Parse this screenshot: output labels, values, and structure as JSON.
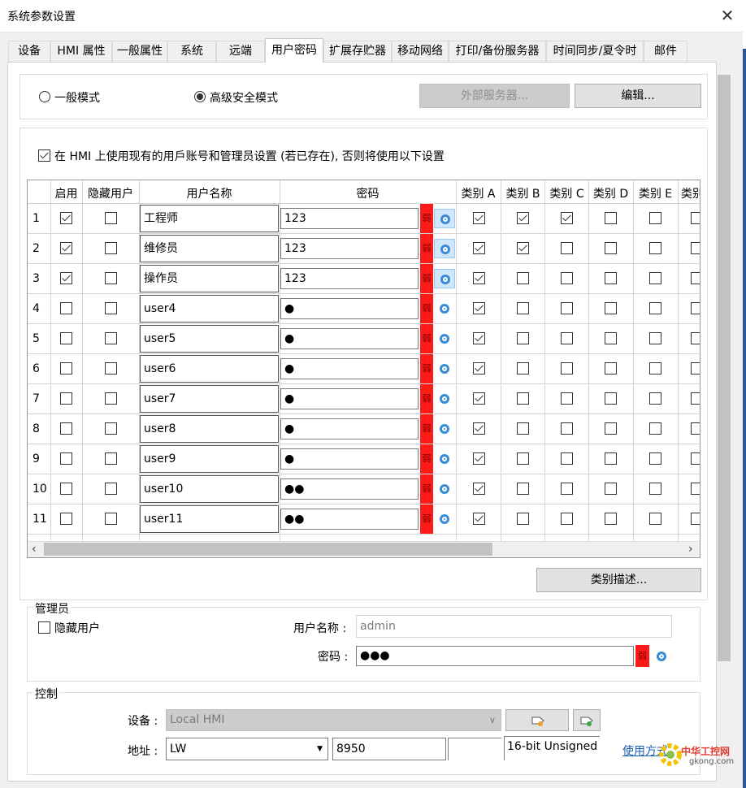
{
  "window": {
    "title": "系统参数设置",
    "close_glyph": "✕"
  },
  "tabs": [
    {
      "label": "设备",
      "active": false
    },
    {
      "label": "HMI 属性",
      "active": false
    },
    {
      "label": "一般属性",
      "active": false
    },
    {
      "label": "系统",
      "active": false
    },
    {
      "label": "远端",
      "active": false
    },
    {
      "label": "用户密码",
      "active": true
    },
    {
      "label": "扩展存贮器",
      "active": false
    },
    {
      "label": "移动网络",
      "active": false
    },
    {
      "label": "打印/备份服务器",
      "active": false
    },
    {
      "label": "时间同步/夏令时",
      "active": false
    },
    {
      "label": "邮件",
      "active": false
    }
  ],
  "mode": {
    "general_label": "一般模式",
    "advanced_label": "高级安全模式",
    "selected": "advanced",
    "external_server_label": "外部服务器...",
    "edit_label": "编辑..."
  },
  "use_existing": {
    "checked": true,
    "label": "在 HMI 上使用现有的用戶账号和管理员设置 (若已存在), 否则将使用以下设置"
  },
  "grid": {
    "headers": {
      "enable": "启用",
      "hidden": "隐藏用户",
      "username": "用户名称",
      "password": "密码",
      "categories": [
        "类别 A",
        "类别 B",
        "类别 C",
        "类别 D",
        "类别 E",
        "类别"
      ]
    },
    "weak_label": "弱",
    "rows": [
      {
        "num": "1",
        "enabled": true,
        "hidden": false,
        "name": "工程师",
        "password": "123",
        "eye_hl": true,
        "cats": [
          true,
          true,
          true,
          false,
          false,
          false
        ]
      },
      {
        "num": "2",
        "enabled": true,
        "hidden": false,
        "name": "维修员",
        "password": "123",
        "eye_hl": true,
        "cats": [
          true,
          true,
          false,
          false,
          false,
          false
        ]
      },
      {
        "num": "3",
        "enabled": true,
        "hidden": false,
        "name": "操作员",
        "password": "123",
        "eye_hl": true,
        "cats": [
          true,
          false,
          false,
          false,
          false,
          false
        ]
      },
      {
        "num": "4",
        "enabled": false,
        "hidden": false,
        "name": "user4",
        "password": "●",
        "eye_hl": false,
        "cats": [
          true,
          false,
          false,
          false,
          false,
          false
        ]
      },
      {
        "num": "5",
        "enabled": false,
        "hidden": false,
        "name": "user5",
        "password": "●",
        "eye_hl": false,
        "cats": [
          true,
          false,
          false,
          false,
          false,
          false
        ]
      },
      {
        "num": "6",
        "enabled": false,
        "hidden": false,
        "name": "user6",
        "password": "●",
        "eye_hl": false,
        "cats": [
          true,
          false,
          false,
          false,
          false,
          false
        ]
      },
      {
        "num": "7",
        "enabled": false,
        "hidden": false,
        "name": "user7",
        "password": "●",
        "eye_hl": false,
        "cats": [
          true,
          false,
          false,
          false,
          false,
          false
        ]
      },
      {
        "num": "8",
        "enabled": false,
        "hidden": false,
        "name": "user8",
        "password": "●",
        "eye_hl": false,
        "cats": [
          true,
          false,
          false,
          false,
          false,
          false
        ]
      },
      {
        "num": "9",
        "enabled": false,
        "hidden": false,
        "name": "user9",
        "password": "●",
        "eye_hl": false,
        "cats": [
          true,
          false,
          false,
          false,
          false,
          false
        ]
      },
      {
        "num": "10",
        "enabled": false,
        "hidden": false,
        "name": "user10",
        "password": "●●",
        "eye_hl": false,
        "cats": [
          true,
          false,
          false,
          false,
          false,
          false
        ]
      },
      {
        "num": "11",
        "enabled": false,
        "hidden": false,
        "name": "user11",
        "password": "●●",
        "eye_hl": false,
        "cats": [
          true,
          false,
          false,
          false,
          false,
          false
        ]
      }
    ]
  },
  "category_desc_label": "类别描述...",
  "admin": {
    "group_label": "管理员",
    "hidden_label": "隐藏用户",
    "hidden_checked": false,
    "username_label": "用户名称 :",
    "username_value": "admin",
    "password_label": "密码 :",
    "password_value": "●●●",
    "weak_label": "弱"
  },
  "control": {
    "group_label": "控制",
    "device_label": "设备 :",
    "device_value": "Local HMI",
    "address_label": "地址 :",
    "address_type": "LW",
    "address_value": "8950",
    "data_format": "16-bit Unsigned",
    "usage_link": "使用方式"
  },
  "watermark": {
    "brand": "中华工控网",
    "site": "gkong.com"
  }
}
